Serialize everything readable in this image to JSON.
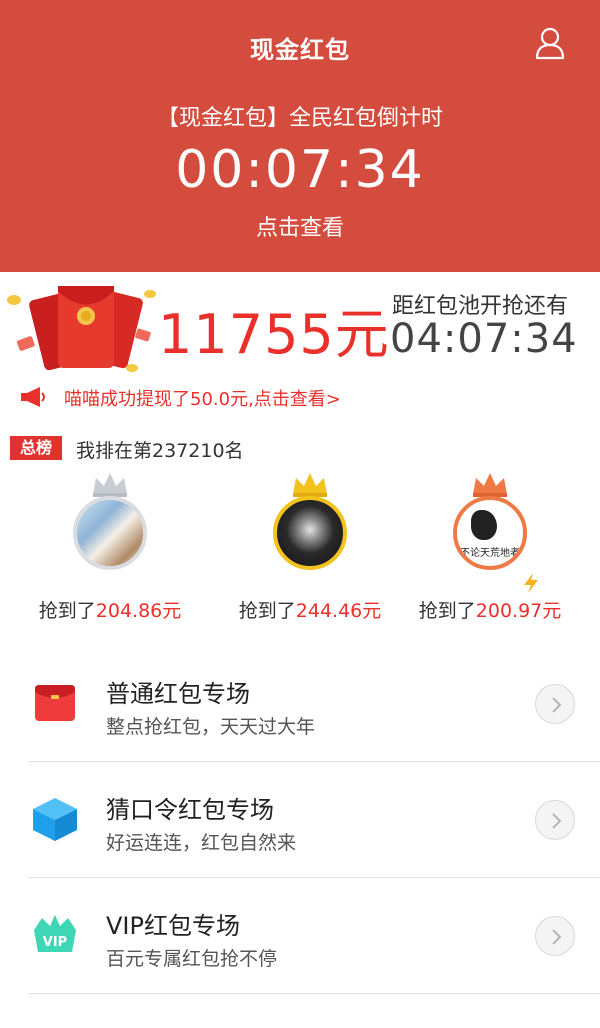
{
  "header": {
    "title": "现金红包",
    "countdown_label": "【现金红包】全民红包倒计时",
    "countdown_time": "00:07:34",
    "view_link": "点击查看"
  },
  "pool": {
    "amount": "11755元",
    "label": "距红包池开抢还有",
    "timer": "04:07:34"
  },
  "marquee": {
    "text": "喵喵成功提现了50.0元,点击查看>"
  },
  "rank": {
    "badge": "总榜",
    "my_rank": "我排在第237210名"
  },
  "winners": [
    {
      "prefix": "抢到了",
      "amount": "204.86元",
      "crown_color": "#c9ccd2"
    },
    {
      "prefix": "抢到了",
      "amount": "244.46元",
      "crown_color": "#f2c21d"
    },
    {
      "prefix": "抢到了",
      "amount": "200.97元",
      "crown_color": "#f07a45",
      "avatar_caption": "不论天荒地老"
    }
  ],
  "list": [
    {
      "title": "普通红包专场",
      "subtitle": "整点抢红包，天天过大年",
      "icon": "red-envelope-icon"
    },
    {
      "title": "猜口令红包专场",
      "subtitle": "好运连连，红包自然来",
      "icon": "blue-box-icon"
    },
    {
      "title": "VIP红包专场",
      "subtitle": "百元专属红包抢不停",
      "icon": "vip-crown-icon"
    }
  ],
  "colors": {
    "header_bg": "#d44c3d",
    "accent_red": "#e9302b",
    "gold": "#f2c21d",
    "vip_green": "#3fd6b5",
    "box_blue": "#1ea0ea"
  }
}
